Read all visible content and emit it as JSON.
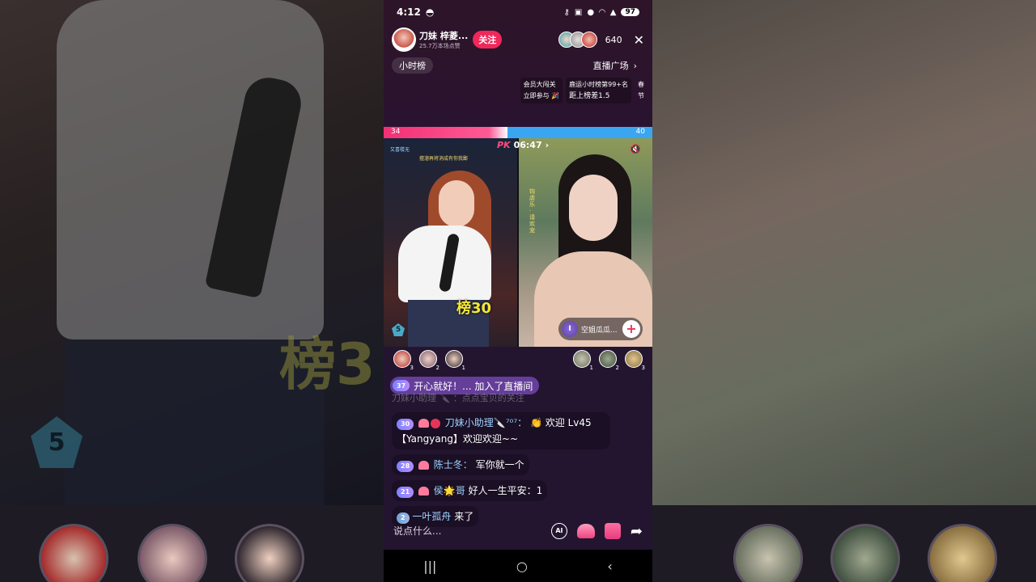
{
  "status": {
    "time": "4:12",
    "battery": "97"
  },
  "host": {
    "name": "刀妹 梓菱...",
    "likes": "25.7万本场点赞",
    "follow_label": "关注",
    "viewer_count": "640"
  },
  "hourly_rank_label": "小时榜",
  "live_plaza_label": "直播广场",
  "events": [
    {
      "line1": "会员大闯关",
      "line2": "立即参与 🎉"
    },
    {
      "line1": "鹿运小时榜第99+名",
      "line2": "距上榜差1.5"
    },
    {
      "line1": "春",
      "line2": "节"
    }
  ],
  "pk": {
    "left_score": "34",
    "right_score": "40",
    "left_ratio": 0.46,
    "timer": "06:47",
    "pk_label": "PK"
  },
  "left_video": {
    "rank_text": "榜30",
    "level": "5",
    "caption_top": "又喜楼无",
    "caption_sub": "擅溜再将消成有你我鄙"
  },
  "right_video": {
    "vertical_text": "钩虐乐 · 请欢宠",
    "opponent_name": "空姐瓜瓜...",
    "opponent_badge": "I"
  },
  "contributors": {
    "left": [
      "3",
      "2",
      "1"
    ],
    "right": [
      "1",
      "2",
      "3"
    ]
  },
  "join_banner": {
    "level": "37",
    "text": "开心就好！... 加入了直播间"
  },
  "chat": {
    "faded": "刀妹小助理 🔪 ：点点宝贝的关注",
    "messages": [
      {
        "level": "30",
        "nick": "刀妹小助理🔪⁷⁰⁷：",
        "text": "👏 欢迎 Lv45 【Yangyang】欢迎欢迎~~"
      },
      {
        "level": "28",
        "nick": "陈士冬：",
        "text": "军你就一个"
      },
      {
        "level": "21",
        "nick": "侯🌟哥",
        "text": "好人一生平安：1"
      },
      {
        "level": "2",
        "nick": "一叶孤舟",
        "text": "来了"
      }
    ]
  },
  "input": {
    "placeholder": "说点什么..."
  },
  "ai_label": "AI",
  "nav": {
    "recents": "|||",
    "home": "○",
    "back": "‹"
  }
}
